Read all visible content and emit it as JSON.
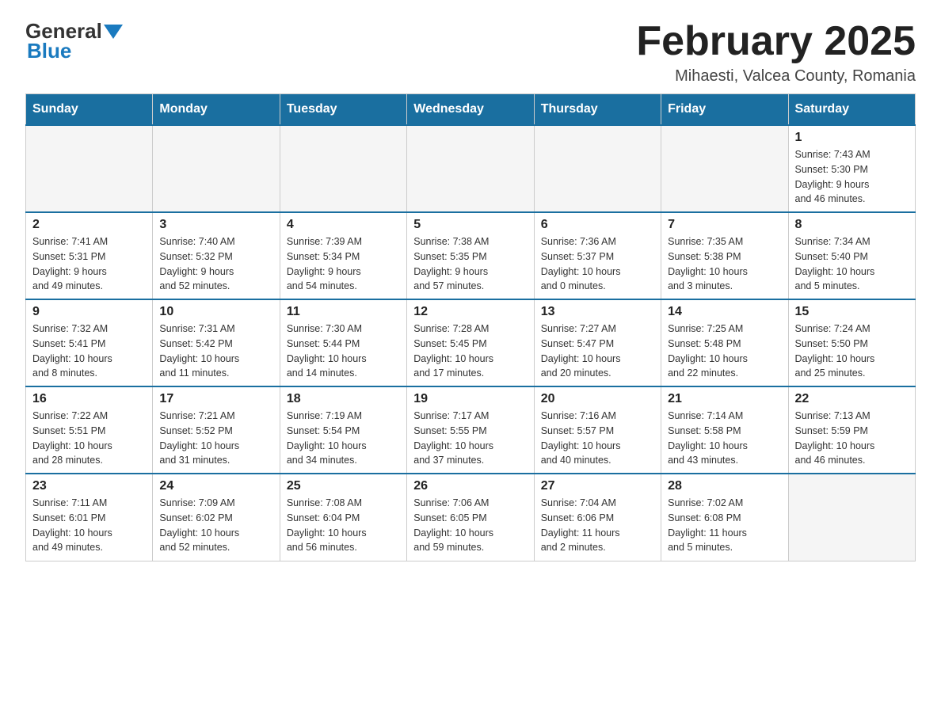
{
  "header": {
    "logo_general": "General",
    "logo_blue": "Blue",
    "month_title": "February 2025",
    "location": "Mihaesti, Valcea County, Romania"
  },
  "days_of_week": [
    "Sunday",
    "Monday",
    "Tuesday",
    "Wednesday",
    "Thursday",
    "Friday",
    "Saturday"
  ],
  "weeks": [
    [
      {
        "day": "",
        "info": ""
      },
      {
        "day": "",
        "info": ""
      },
      {
        "day": "",
        "info": ""
      },
      {
        "day": "",
        "info": ""
      },
      {
        "day": "",
        "info": ""
      },
      {
        "day": "",
        "info": ""
      },
      {
        "day": "1",
        "info": "Sunrise: 7:43 AM\nSunset: 5:30 PM\nDaylight: 9 hours\nand 46 minutes."
      }
    ],
    [
      {
        "day": "2",
        "info": "Sunrise: 7:41 AM\nSunset: 5:31 PM\nDaylight: 9 hours\nand 49 minutes."
      },
      {
        "day": "3",
        "info": "Sunrise: 7:40 AM\nSunset: 5:32 PM\nDaylight: 9 hours\nand 52 minutes."
      },
      {
        "day": "4",
        "info": "Sunrise: 7:39 AM\nSunset: 5:34 PM\nDaylight: 9 hours\nand 54 minutes."
      },
      {
        "day": "5",
        "info": "Sunrise: 7:38 AM\nSunset: 5:35 PM\nDaylight: 9 hours\nand 57 minutes."
      },
      {
        "day": "6",
        "info": "Sunrise: 7:36 AM\nSunset: 5:37 PM\nDaylight: 10 hours\nand 0 minutes."
      },
      {
        "day": "7",
        "info": "Sunrise: 7:35 AM\nSunset: 5:38 PM\nDaylight: 10 hours\nand 3 minutes."
      },
      {
        "day": "8",
        "info": "Sunrise: 7:34 AM\nSunset: 5:40 PM\nDaylight: 10 hours\nand 5 minutes."
      }
    ],
    [
      {
        "day": "9",
        "info": "Sunrise: 7:32 AM\nSunset: 5:41 PM\nDaylight: 10 hours\nand 8 minutes."
      },
      {
        "day": "10",
        "info": "Sunrise: 7:31 AM\nSunset: 5:42 PM\nDaylight: 10 hours\nand 11 minutes."
      },
      {
        "day": "11",
        "info": "Sunrise: 7:30 AM\nSunset: 5:44 PM\nDaylight: 10 hours\nand 14 minutes."
      },
      {
        "day": "12",
        "info": "Sunrise: 7:28 AM\nSunset: 5:45 PM\nDaylight: 10 hours\nand 17 minutes."
      },
      {
        "day": "13",
        "info": "Sunrise: 7:27 AM\nSunset: 5:47 PM\nDaylight: 10 hours\nand 20 minutes."
      },
      {
        "day": "14",
        "info": "Sunrise: 7:25 AM\nSunset: 5:48 PM\nDaylight: 10 hours\nand 22 minutes."
      },
      {
        "day": "15",
        "info": "Sunrise: 7:24 AM\nSunset: 5:50 PM\nDaylight: 10 hours\nand 25 minutes."
      }
    ],
    [
      {
        "day": "16",
        "info": "Sunrise: 7:22 AM\nSunset: 5:51 PM\nDaylight: 10 hours\nand 28 minutes."
      },
      {
        "day": "17",
        "info": "Sunrise: 7:21 AM\nSunset: 5:52 PM\nDaylight: 10 hours\nand 31 minutes."
      },
      {
        "day": "18",
        "info": "Sunrise: 7:19 AM\nSunset: 5:54 PM\nDaylight: 10 hours\nand 34 minutes."
      },
      {
        "day": "19",
        "info": "Sunrise: 7:17 AM\nSunset: 5:55 PM\nDaylight: 10 hours\nand 37 minutes."
      },
      {
        "day": "20",
        "info": "Sunrise: 7:16 AM\nSunset: 5:57 PM\nDaylight: 10 hours\nand 40 minutes."
      },
      {
        "day": "21",
        "info": "Sunrise: 7:14 AM\nSunset: 5:58 PM\nDaylight: 10 hours\nand 43 minutes."
      },
      {
        "day": "22",
        "info": "Sunrise: 7:13 AM\nSunset: 5:59 PM\nDaylight: 10 hours\nand 46 minutes."
      }
    ],
    [
      {
        "day": "23",
        "info": "Sunrise: 7:11 AM\nSunset: 6:01 PM\nDaylight: 10 hours\nand 49 minutes."
      },
      {
        "day": "24",
        "info": "Sunrise: 7:09 AM\nSunset: 6:02 PM\nDaylight: 10 hours\nand 52 minutes."
      },
      {
        "day": "25",
        "info": "Sunrise: 7:08 AM\nSunset: 6:04 PM\nDaylight: 10 hours\nand 56 minutes."
      },
      {
        "day": "26",
        "info": "Sunrise: 7:06 AM\nSunset: 6:05 PM\nDaylight: 10 hours\nand 59 minutes."
      },
      {
        "day": "27",
        "info": "Sunrise: 7:04 AM\nSunset: 6:06 PM\nDaylight: 11 hours\nand 2 minutes."
      },
      {
        "day": "28",
        "info": "Sunrise: 7:02 AM\nSunset: 6:08 PM\nDaylight: 11 hours\nand 5 minutes."
      },
      {
        "day": "",
        "info": ""
      }
    ]
  ]
}
